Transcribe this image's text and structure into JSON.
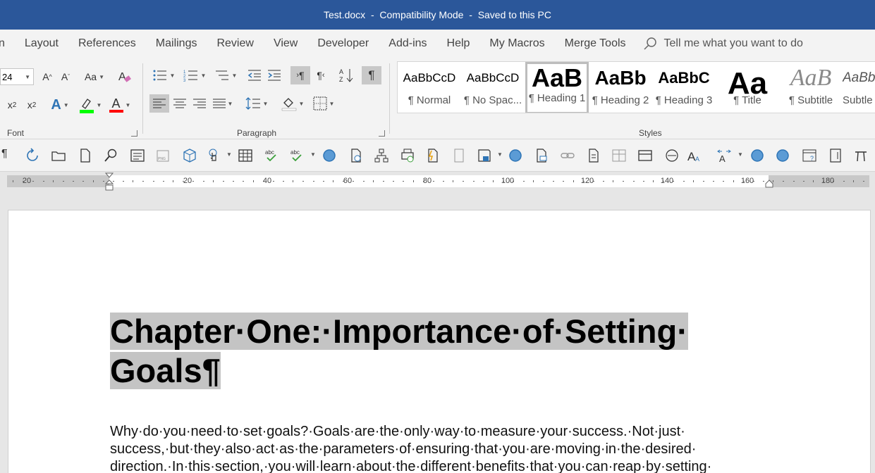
{
  "window": {
    "doc_name": "Test.docx",
    "mode": "Compatibility Mode",
    "save_status": "Saved to this PC",
    "separator": "-"
  },
  "tabs": [
    {
      "label": "n"
    },
    {
      "label": "Layout"
    },
    {
      "label": "References"
    },
    {
      "label": "Mailings"
    },
    {
      "label": "Review"
    },
    {
      "label": "View"
    },
    {
      "label": "Developer"
    },
    {
      "label": "Add-ins"
    },
    {
      "label": "Help"
    },
    {
      "label": "My Macros"
    },
    {
      "label": "Merge Tools"
    }
  ],
  "tell_me": {
    "placeholder": "Tell me what you want to do",
    "icon": "lightbulb-search-icon"
  },
  "font_group": {
    "label": "Font",
    "font_size": "24",
    "grow_label": "A",
    "shrink_label": "A",
    "case_label": "Aa",
    "subscript_label": "x",
    "subscript_sub": "2",
    "superscript_label": "x",
    "superscript_sup": "2",
    "text_effects_label": "A",
    "font_color_label": "A",
    "highlight_color": "#00ff00",
    "font_color": "#ff0000"
  },
  "paragraph_group": {
    "label": "Paragraph",
    "ltr_label": "¶",
    "rtl_label": "¶",
    "show_marks_label": "¶"
  },
  "styles_group": {
    "label": "Styles",
    "items": [
      {
        "sample": "AaBbCcD",
        "name": "¶ Normal"
      },
      {
        "sample": "AaBbCcD",
        "name": "¶ No Spac..."
      },
      {
        "sample": "AaB",
        "name": "¶ Heading 1"
      },
      {
        "sample": "AaBb",
        "name": "¶ Heading 2"
      },
      {
        "sample": "AaBbC",
        "name": "¶ Heading 3"
      },
      {
        "sample": "Aa",
        "name": "¶ Title"
      },
      {
        "sample": "AaB",
        "name": "¶ Subtitle"
      },
      {
        "sample": "AaBb",
        "name": "Subtle"
      }
    ]
  },
  "quick_toolbar": {
    "first_label": "¶"
  },
  "ruler": {
    "labels": [
      "20",
      "20",
      "40",
      "60",
      "80",
      "100",
      "120",
      "140",
      "160",
      "180"
    ]
  },
  "document": {
    "heading_line1": "Chapter·One:·Importance·of·Setting·",
    "heading_line2": "Goals¶",
    "body_lines": [
      "Why·do·you·need·to·set·goals?·Goals·are·the·only·way·to·measure·your·success.·Not·just·",
      "success,·but·they·also·act·as·the·parameters·of·ensuring·that·you·are·moving·in·the·desired·",
      "direction.·In·this·section,·you·will·learn·about·the·different·benefits·that·you·can·reap·by·setting·"
    ]
  },
  "colors": {
    "title_bar": "#2b579a",
    "ribbon": "#f3f3f3",
    "selection_highlight": "#c4c4c4"
  }
}
